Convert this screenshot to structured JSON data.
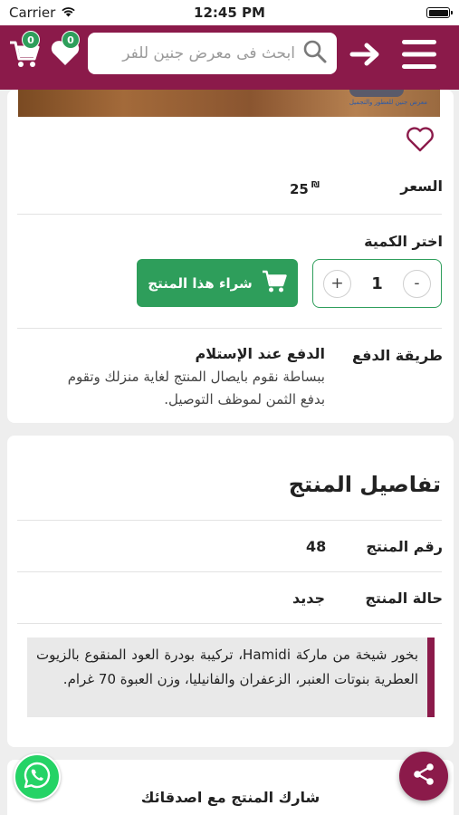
{
  "status_bar": {
    "carrier": "Carrier",
    "time": "12:45 PM"
  },
  "header": {
    "cart_count": "0",
    "wishlist_count": "0",
    "search_placeholder": "ابحث فى معرض جنين للفر",
    "color": "#8b1a4a"
  },
  "product_image": {
    "brand_caption": "معرض جنين للعطور والتجميل"
  },
  "purchase": {
    "price_label": "السعر",
    "price_value": "25",
    "currency_symbol": "₪",
    "quantity_label": "اختر الكمية",
    "quantity": "1",
    "minus_label": "-",
    "plus_label": "+",
    "buy_label": "شراء هذا المنتج",
    "payment_label": "طريقة الدفع",
    "payment_method": "الدفع عند الإستلام",
    "payment_description": "ببساطة نقوم بايصال المنتج لغاية منزلك وتقوم بدفع الثمن لموظف التوصيل."
  },
  "details": {
    "title": "تفاصيل المنتج",
    "product_number_label": "رقم المنتج",
    "product_number": "48",
    "condition_label": "حالة المنتج",
    "condition": "جديد",
    "description": "بخور شيخة من ماركة Hamidi، تركيبة بودرة العود المنقوع بالزيوت العطرية بنوتات العنبر، الزعفران والفانيليا، وزن العبوة 70 غرام."
  },
  "share": {
    "label": "شارك المنتج مع اصدقائك"
  },
  "colors": {
    "primary": "#8b1a4a",
    "accent": "#2e9e5b",
    "whatsapp": "#25d366"
  },
  "icons": [
    "wifi-icon",
    "battery-icon",
    "cart-icon",
    "heart-icon",
    "search-icon",
    "arrow-right-icon",
    "menu-icon",
    "heart-outline-icon",
    "cart-icon",
    "whatsapp-icon",
    "share-icon"
  ]
}
